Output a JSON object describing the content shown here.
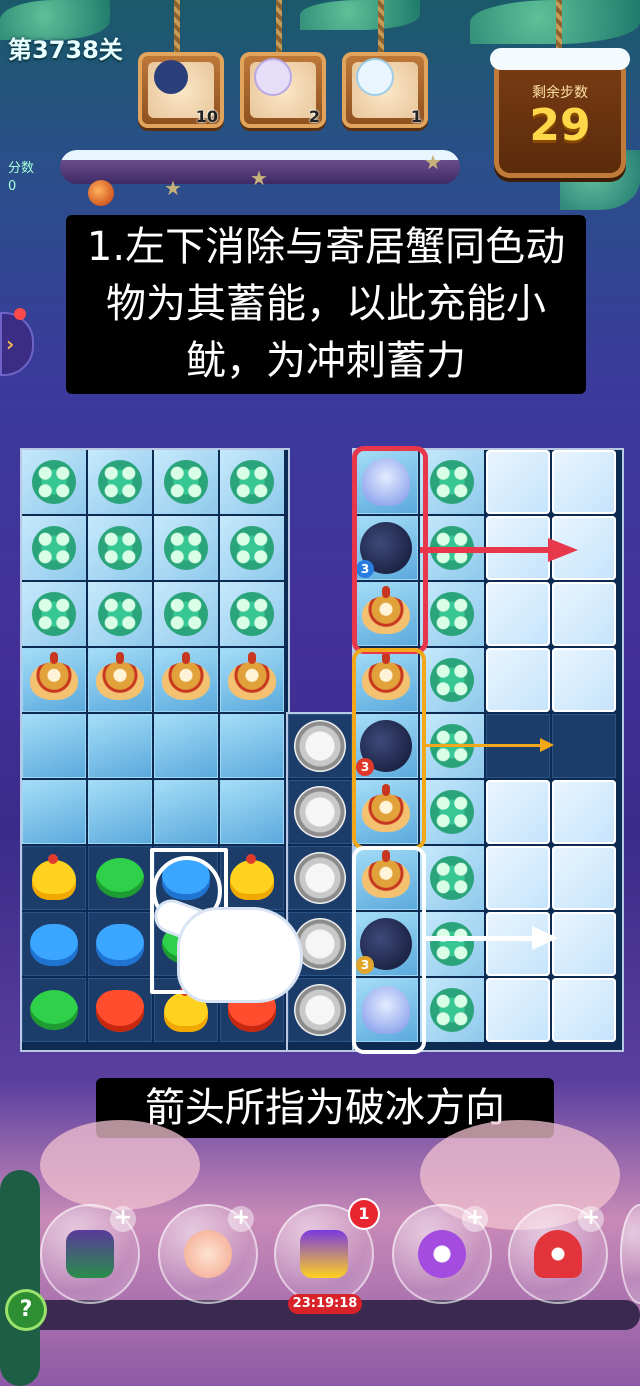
{
  "level": {
    "label": "第3738关"
  },
  "score": {
    "label": "分数",
    "value": "0"
  },
  "goals": [
    {
      "animal": "penguin",
      "count": "10",
      "color": "#2a3f7a"
    },
    {
      "animal": "seal",
      "count": "2",
      "color": "#e6ddf8"
    },
    {
      "animal": "polar-bear",
      "count": "1",
      "color": "#e9f6ff"
    }
  ],
  "moves": {
    "title": "剩余步数",
    "value": "29"
  },
  "tips": {
    "caption_top": "1.左下消除与寄居蟹同色动物为其蓄能，以此充能小鱿，为冲刺蓄力",
    "caption_bottom": "箭头所指为破冰方向"
  },
  "crab_badges": [
    "3",
    "3",
    "3"
  ],
  "highlights": {
    "red": "#e8364a",
    "orange": "#f2a818",
    "white": "#ffffff"
  },
  "boosters": [
    {
      "name": "shuffle",
      "badge": ""
    },
    {
      "name": "clock",
      "badge": ""
    },
    {
      "name": "owl-chick",
      "badge": "1",
      "timer": "23:19:18"
    },
    {
      "name": "arrows",
      "badge": ""
    },
    {
      "name": "rocket",
      "badge": ""
    }
  ],
  "help_label": "?"
}
